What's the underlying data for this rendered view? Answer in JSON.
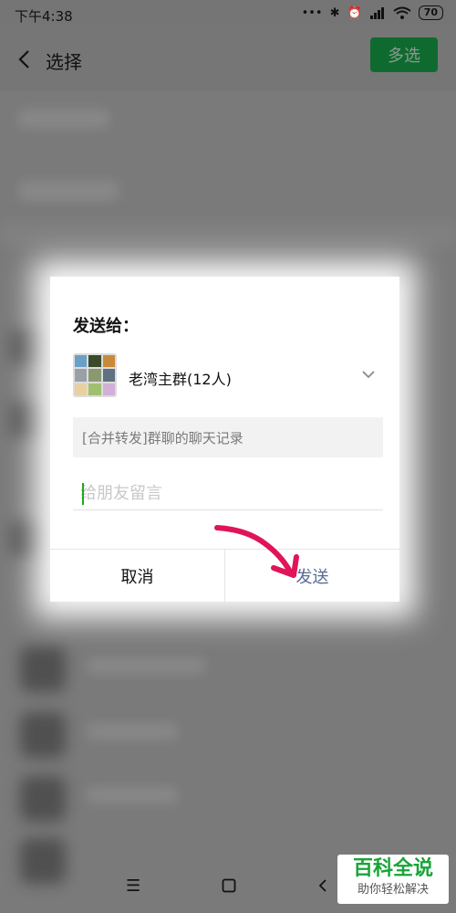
{
  "status_bar": {
    "time": "下午4:38",
    "battery": "70"
  },
  "header": {
    "title": "选择",
    "multi_select": "多选"
  },
  "dialog": {
    "heading": "发送给：",
    "recipient": "老湾主群(12人)",
    "quoted": "[合并转发]群聊的聊天记录",
    "input_placeholder": "给朋友留言",
    "cancel": "取消",
    "send": "发送"
  },
  "watermark": {
    "main": "百科全说",
    "sub": "助你轻松解决"
  },
  "colors": {
    "accent_green": "#1aad19",
    "link_blue": "#576b95",
    "annotation_pink": "#e0145a"
  }
}
